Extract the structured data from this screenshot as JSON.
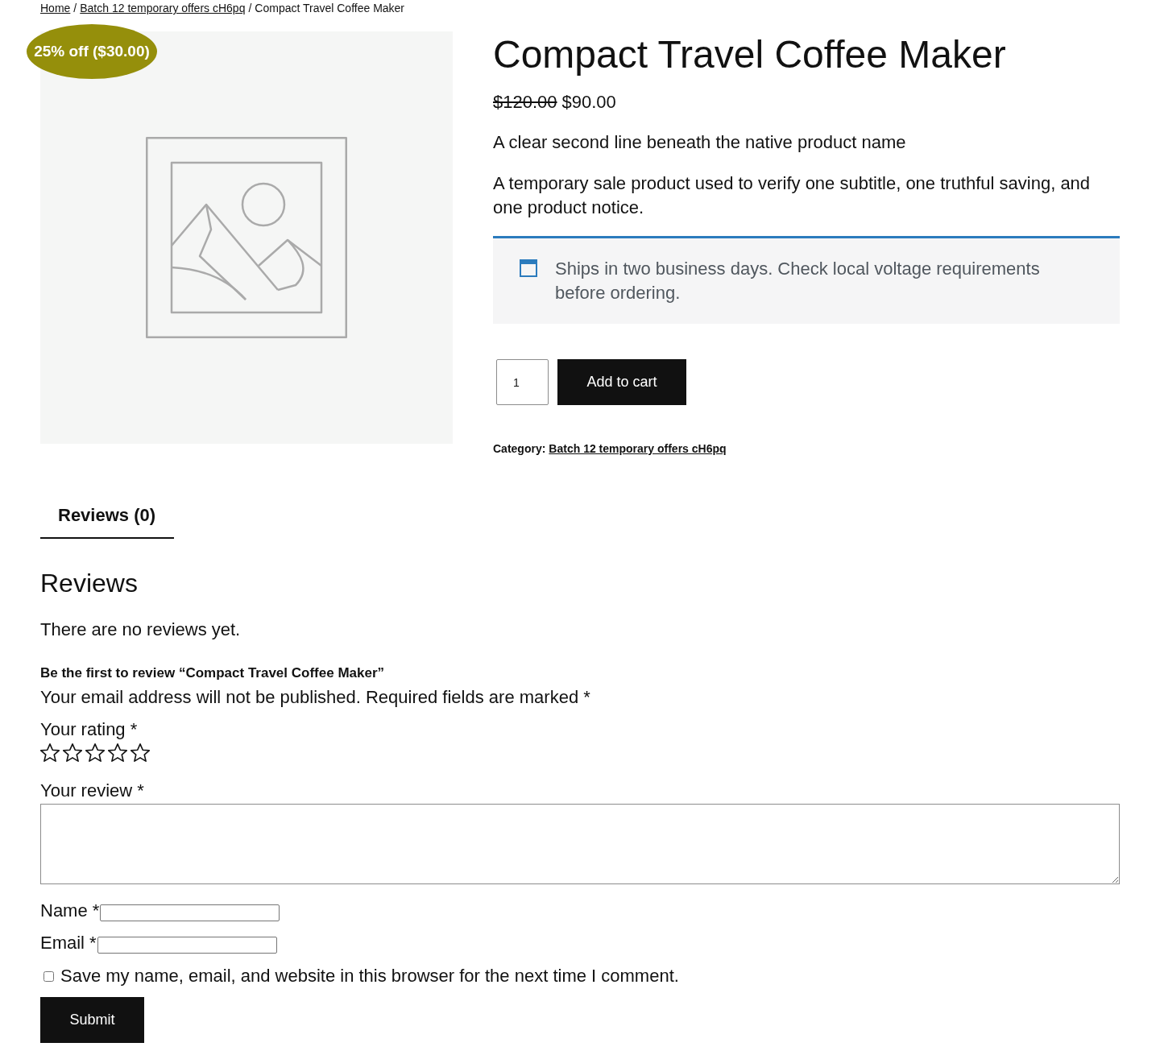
{
  "breadcrumb": [
    {
      "kind": "link",
      "label": "Home"
    },
    {
      "kind": "separator",
      "label": "/"
    },
    {
      "kind": "link",
      "label": "Batch 12 temporary offers cH6pq"
    },
    {
      "kind": "separator",
      "label": "/"
    },
    {
      "kind": "current",
      "label": "Compact Travel Coffee Maker"
    }
  ],
  "product": {
    "sale_badge": "25% off ($30.00)",
    "title": "Compact Travel Coffee Maker",
    "price": {
      "regular": "$120.00",
      "sale": "$90.00"
    },
    "subtitle": "A clear second line beneath the native product name",
    "description": "A temporary sale product used to verify one subtitle, one truthful saving, and one product notice.",
    "notice": "Ships in two business days. Check local voltage requirements before ordering.",
    "quantity": "1",
    "add_to_cart": "Add to cart",
    "category": {
      "label": "Category:",
      "link": "Batch 12 temporary offers cH6pq"
    }
  },
  "tabs": [
    {
      "label": "Reviews (0)",
      "selected": true
    }
  ],
  "reviews": {
    "heading": "Reviews",
    "empty_text": "There are no reviews yet.",
    "form": {
      "title": "Be the first to review “Compact Travel Coffee Maker”",
      "note": "Your email address will not be published. Required fields are marked *",
      "rating": {
        "label": "Your rating *",
        "stars": 0
      },
      "review": {
        "label": "Your review *"
      },
      "name": {
        "label": "Name *"
      },
      "email": {
        "label": "Email *"
      },
      "save_info": {
        "label": "Save my name, email, and website in this browser for the next time I comment.",
        "checked": false
      },
      "submit": "Submit"
    }
  }
}
